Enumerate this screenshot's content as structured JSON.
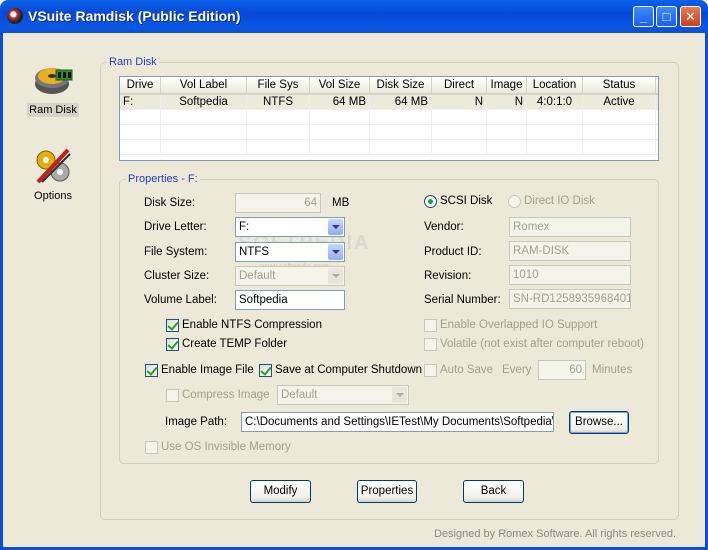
{
  "window": {
    "title": "VSuite Ramdisk (Public Edition)"
  },
  "sidebar": {
    "ramdisk_label": "Ram Disk",
    "options_label": "Options"
  },
  "ramdisk_group": {
    "title": "Ram Disk"
  },
  "table": {
    "columns": [
      "Drive",
      "Vol Label",
      "File Sys",
      "Vol Size",
      "Disk Size",
      "Direct",
      "Image",
      "Location",
      "Status"
    ],
    "rows": [
      [
        "F:",
        "Softpedia",
        "NTFS",
        "64 MB",
        "64 MB",
        "N",
        "N",
        "4:0:1:0",
        "Active"
      ]
    ]
  },
  "properties": {
    "title": "Properties - F:",
    "disk_size_label": "Disk Size:",
    "disk_size_value": "64",
    "disk_size_unit": "MB",
    "drive_letter_label": "Drive Letter:",
    "drive_letter_value": "F:",
    "file_system_label": "File System:",
    "file_system_value": "NTFS",
    "cluster_size_label": "Cluster Size:",
    "cluster_size_value": "Default",
    "volume_label_label": "Volume Label:",
    "volume_label_value": "Softpedia",
    "enable_ntfs_compression": "Enable NTFS Compression",
    "create_temp_folder": "Create TEMP Folder",
    "enable_image_file": "Enable Image File",
    "save_at_shutdown": "Save at Computer Shutdown",
    "compress_image": "Compress Image",
    "compress_image_value": "Default",
    "image_path_label": "Image Path:",
    "image_path_value": "C:\\Documents and Settings\\IETest\\My Documents\\Softpedia\\Sc",
    "browse_button": "Browse...",
    "use_os_invisible_memory": "Use OS Invisible Memory",
    "scsi_disk": "SCSI Disk",
    "direct_io_disk": "Direct IO Disk",
    "vendor_label": "Vendor:",
    "vendor_value": "Romex",
    "product_id_label": "Product ID:",
    "product_id_value": "RAM-DISK",
    "revision_label": "Revision:",
    "revision_value": "1010",
    "serial_label": "Serial Number:",
    "serial_value": "SN-RD1258935968401(",
    "enable_overlapped_io": "Enable Overlapped IO Support",
    "volatile": "Volatile (not exist after computer reboot)",
    "auto_save": "Auto Save",
    "every_label": "Every",
    "every_value": "60",
    "minutes_label": "Minutes"
  },
  "buttons": {
    "modify": "Modify",
    "properties": "Properties",
    "back": "Back"
  },
  "watermark": {
    "text": "SOFTPEDIA",
    "sub": "www.softpedia.com"
  },
  "footer": "Designed by Romex Software. All rights reserved."
}
